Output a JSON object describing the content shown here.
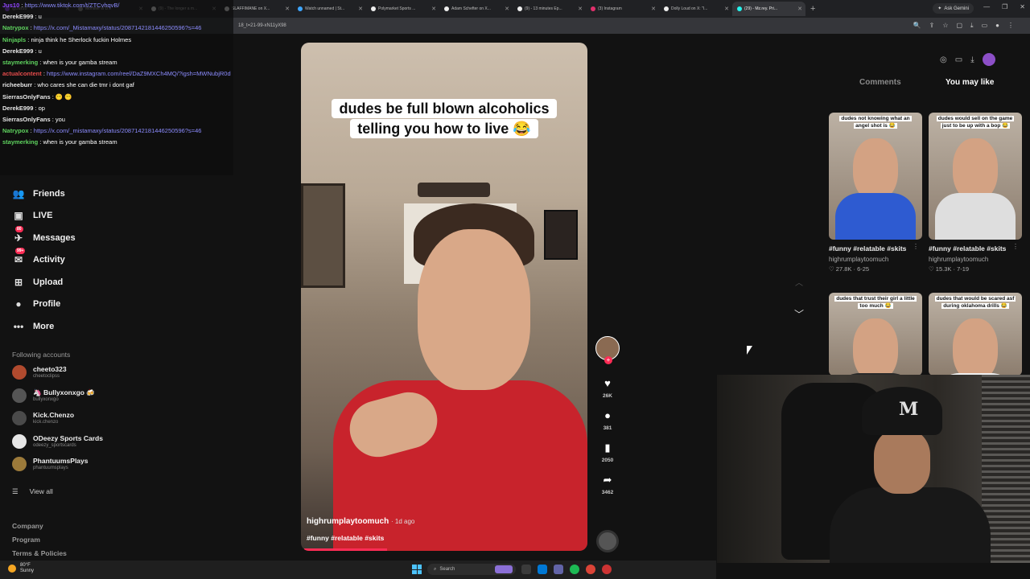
{
  "browser": {
    "tabs": [
      {
        "title": "@Jus10",
        "color": "#9147ff"
      },
      {
        "title": "Monster in D...",
        "color": "#888888"
      },
      {
        "title": "(9) - The longer a m...",
        "color": "#eeeeee"
      },
      {
        "title": "SLAFFIMANE on X...",
        "color": "#eeeeee"
      },
      {
        "title": "Watch unnamed | St...",
        "color": "#3ea6ff"
      },
      {
        "title": "Polymarket Sports ...",
        "color": "#eeeeee"
      },
      {
        "title": "Adam Schefter on X...",
        "color": "#eeeeee"
      },
      {
        "title": "(9) - 13 minutes Ep...",
        "color": "#eeeeee"
      },
      {
        "title": "(3) Instagram",
        "color": "#e1306c"
      },
      {
        "title": "Dolly Loud on X: \"I...",
        "color": "#eeeeee"
      },
      {
        "title": "(29) - Mz.rey. Pri...",
        "color": "#25f4ee"
      }
    ],
    "new_tab": "+",
    "ask_gemini": "Ask Gemini",
    "url": "18_t=21-99-xN11yX98",
    "win_controls": [
      "—",
      "❐",
      "✕"
    ]
  },
  "chat": {
    "messages": [
      {
        "user": "Jus10",
        "ucolor": "#9147ff",
        "text": "https://www.tiktok.com/t/ZTCvhqvB/",
        "link": true
      },
      {
        "user": "DerekE999",
        "ucolor": "#e8e8e8",
        "text": "u",
        "link": false
      },
      {
        "user": "Natrypox",
        "ucolor": "#5fd35f",
        "text": "https://x.com/_Mistamaxy/status/2087142181446250596?s=46",
        "link": true
      },
      {
        "user": "Ninjapls",
        "ucolor": "#5fd35f",
        "text": "ninja think he Sherlock fuckin Holmes",
        "link": false
      },
      {
        "user": "DerekE999",
        "ucolor": "#e8e8e8",
        "text": "u",
        "link": false
      },
      {
        "user": "staymerking",
        "ucolor": "#5fd35f",
        "text": "when is your gamba stream",
        "link": false
      },
      {
        "user": "actualcontent",
        "ucolor": "#e24b4b",
        "text": "https://www.instagram.com/reel/DaZ9MXCh4MQ/?igsh=MWNubjR0dG11MGg4bA==",
        "link": true
      },
      {
        "user": "richeeburr",
        "ucolor": "#e8e8e8",
        "text": "who cares she can die tmr i dont gaf",
        "link": false
      },
      {
        "user": "SierrasOnlyFans",
        "ucolor": "#e8e8e8",
        "text": "😶 😶",
        "link": false
      },
      {
        "user": "DerekE999",
        "ucolor": "#e8e8e8",
        "text": "op",
        "link": false
      },
      {
        "user": "SierrasOnlyFans",
        "ucolor": "#e8e8e8",
        "text": "you",
        "link": false
      },
      {
        "user": "Natrypox",
        "ucolor": "#5fd35f",
        "text": "https://x.com/_mistamaxy/status/2087142181446250596?s=46",
        "link": true
      },
      {
        "user": "staymerking",
        "ucolor": "#5fd35f",
        "text": "when is your gamba stream",
        "link": false
      }
    ]
  },
  "sidebar": {
    "nav": [
      {
        "label": "Friends",
        "icon": "friends-icon",
        "glyph": "👥",
        "badge": ""
      },
      {
        "label": "LIVE",
        "icon": "live-icon",
        "glyph": "▣",
        "badge": ""
      },
      {
        "label": "Messages",
        "icon": "messages-icon",
        "glyph": "✈",
        "badge": "80"
      },
      {
        "label": "Activity",
        "icon": "activity-icon",
        "glyph": "✉",
        "badge": "99+"
      },
      {
        "label": "Upload",
        "icon": "upload-icon",
        "glyph": "⊞",
        "badge": ""
      },
      {
        "label": "Profile",
        "icon": "profile-icon",
        "glyph": "●",
        "badge": ""
      },
      {
        "label": "More",
        "icon": "more-icon",
        "glyph": "•••",
        "badge": ""
      }
    ],
    "following_header": "Following accounts",
    "following": [
      {
        "name": "cheeto323",
        "handle": "cheetoclipss"
      },
      {
        "name": "🦄 Bullyxonxgo 🍻",
        "handle": "bullyxonxgo"
      },
      {
        "name": "Kick.Chenzo",
        "handle": "kick.chenzo"
      },
      {
        "name": "ODeezy Sports Cards",
        "handle": "odeezy_sportscards"
      },
      {
        "name": "PhantuumsPlays",
        "handle": "phantuumsplays"
      }
    ],
    "view_all": "View all",
    "footer": [
      "Company",
      "Program",
      "Terms & Policies"
    ]
  },
  "video": {
    "caption_line1": "dudes be full blown alcoholics",
    "caption_line2": "telling you how to live 😂",
    "author": "highrumplaytoomuch",
    "age": "· 1d ago",
    "tags": "#funny #relatable #skits",
    "progress": 0.29
  },
  "actions": {
    "likes": "26K",
    "comments": "381",
    "saves": "2050",
    "shares": "3462"
  },
  "right_panel": {
    "tab_comments": "Comments",
    "tab_you_may_like": "You may like",
    "suggestions": [
      {
        "caption": "dudes not knowing what an angel shot is 😂",
        "tags": "#funny #relatable #skits",
        "author": "highrumplaytoomuch",
        "stats": "♡ 27.8K · 6-25",
        "shirt": "#2e5bd1"
      },
      {
        "caption": "dudes would sell on the game just to be up with a bop 😂",
        "tags": "#funny #relatable #skits",
        "author": "highrumplaytoomuch",
        "stats": "♡ 15.3K · 7-19",
        "shirt": "#dedede"
      },
      {
        "caption": "dudes that trust their girl a little too much 😂",
        "tags": "",
        "author": "",
        "stats": "",
        "shirt": "#2a2a2a"
      },
      {
        "caption": "dudes that would be scared asf during oklahoma drills 😂",
        "tags": "",
        "author": "",
        "stats": "",
        "shirt": "#f0f0f0"
      }
    ]
  },
  "webcam": {
    "cap_logo": "M"
  },
  "taskbar": {
    "weather_temp": "80°F",
    "weather_desc": "Sunny",
    "search_placeholder": "Search"
  }
}
